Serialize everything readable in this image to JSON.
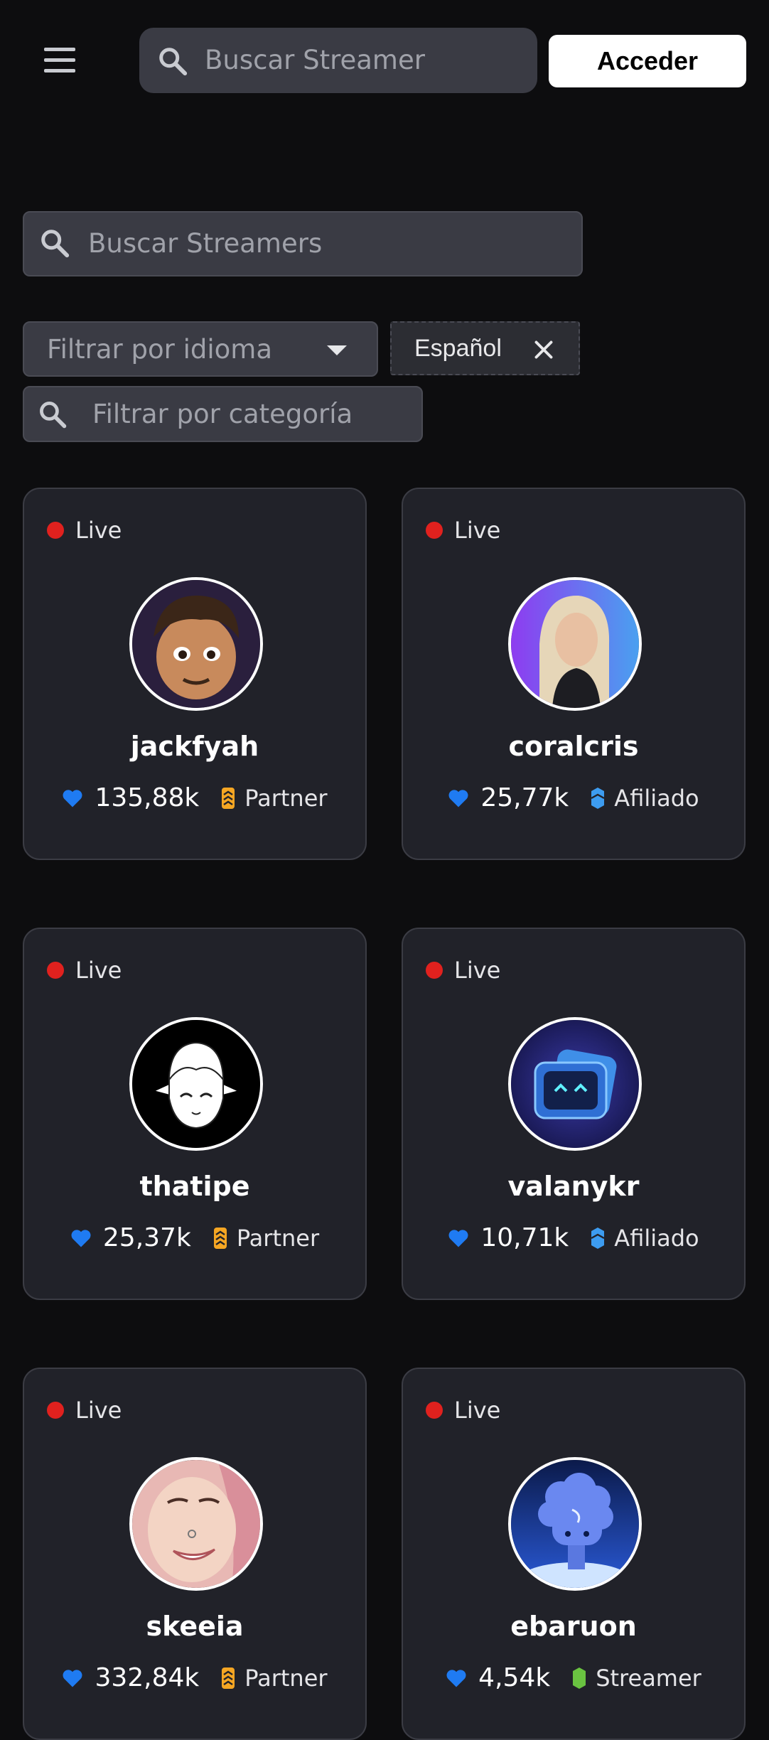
{
  "header": {
    "search_placeholder": "Buscar Streamer",
    "login_label": "Acceder"
  },
  "filters": {
    "streamer_search_placeholder": "Buscar Streamers",
    "language_placeholder": "Filtrar por idioma",
    "selected_language": "Español",
    "category_placeholder": "Filtrar por categoría"
  },
  "colors": {
    "live": "#e0211e",
    "heart": "#1f7bf2",
    "partner": "#f5a623",
    "afiliado": "#3d9cf0",
    "streamer": "#6ac341"
  },
  "streamers": [
    {
      "status": "Live",
      "name": "jackfyah",
      "followers": "135,88k",
      "role": "Partner",
      "role_icon": "partner-badge-icon"
    },
    {
      "status": "Live",
      "name": "coralcris",
      "followers": "25,77k",
      "role": "Afiliado",
      "role_icon": "afiliado-badge-icon"
    },
    {
      "status": "Live",
      "name": "thatipe",
      "followers": "25,37k",
      "role": "Partner",
      "role_icon": "partner-badge-icon"
    },
    {
      "status": "Live",
      "name": "valanykr",
      "followers": "10,71k",
      "role": "Afiliado",
      "role_icon": "afiliado-badge-icon"
    },
    {
      "status": "Live",
      "name": "skeeia",
      "followers": "332,84k",
      "role": "Partner",
      "role_icon": "partner-badge-icon"
    },
    {
      "status": "Live",
      "name": "ebaruon",
      "followers": "4,54k",
      "role": "Streamer",
      "role_icon": "streamer-badge-icon"
    }
  ]
}
